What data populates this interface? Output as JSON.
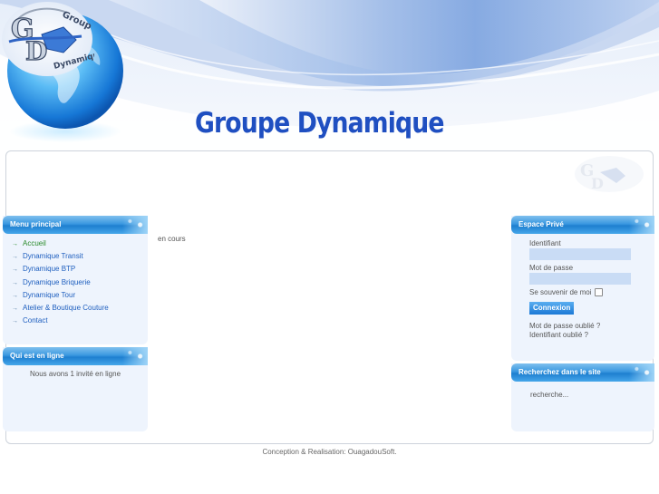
{
  "site": {
    "title": "Groupe Dynamique",
    "logo_text_top": "Groupe",
    "logo_text_bottom": "Dynamique",
    "logo_letters": "GD"
  },
  "menu_principal": {
    "title": "Menu principal",
    "items": [
      {
        "label": "Accueil",
        "active": true
      },
      {
        "label": "Dynamique Transit",
        "active": false
      },
      {
        "label": "Dynamique BTP",
        "active": false
      },
      {
        "label": "Dynamique Briquerie",
        "active": false
      },
      {
        "label": "Dynamique Tour",
        "active": false
      },
      {
        "label": "Atelier & Boutique Couture",
        "active": false
      },
      {
        "label": "Contact",
        "active": false
      }
    ]
  },
  "online": {
    "title": "Qui est en ligne",
    "text": "Nous avons 1 invité en ligne"
  },
  "main": {
    "text": "en cours"
  },
  "espace_prive": {
    "title": "Espace Privé",
    "identifiant_label": "Identifiant",
    "identifiant_value": "",
    "password_label": "Mot de passe",
    "password_value": "",
    "remember_label": "Se souvenir de moi",
    "remember_checked": false,
    "login_button": "Connexion",
    "forgot_password": "Mot de passe oublié ?",
    "forgot_username": "Identifiant oublié ?"
  },
  "search": {
    "title": "Recherchez dans le site",
    "value": "recherche..."
  },
  "footer": {
    "text": "Conception & Realisation: OuagadouSoft."
  },
  "colors": {
    "title_blue": "#1f4fc1",
    "link_blue": "#1f5fbf",
    "active_green": "#2a8a2a",
    "module_blue": "#2e8de0",
    "module_body": "#eef4fd"
  }
}
